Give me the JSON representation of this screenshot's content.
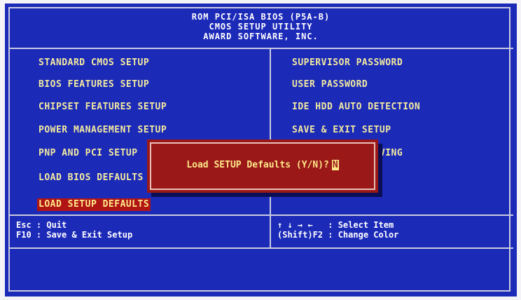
{
  "header": {
    "line1": "ROM PCI/ISA BIOS (P5A-B)",
    "line2": "CMOS SETUP UTILITY",
    "line3": "AWARD SOFTWARE, INC."
  },
  "menu_left": [
    {
      "label": "STANDARD CMOS SETUP"
    },
    {
      "label": "BIOS FEATURES SETUP"
    },
    {
      "label": "CHIPSET FEATURES SETUP"
    },
    {
      "label": "POWER MANAGEMENT SETUP"
    },
    {
      "label": "PNP AND PCI SETUP"
    },
    {
      "label": "LOAD BIOS DEFAULTS"
    },
    {
      "label": "LOAD SETUP DEFAULTS"
    }
  ],
  "menu_right": [
    {
      "label": "SUPERVISOR PASSWORD"
    },
    {
      "label": "USER PASSWORD"
    },
    {
      "label": "IDE HDD AUTO DETECTION"
    },
    {
      "label": "SAVE & EXIT SETUP"
    },
    {
      "label": "EXIT WITHOUT SAVING"
    }
  ],
  "selected_item": "LOAD SETUP DEFAULTS",
  "help": {
    "left1": "Esc : Quit",
    "left2": "F10 : Save & Exit Setup",
    "right1": "↑ ↓ → ←   : Select Item",
    "right2": "(Shift)F2 : Change Color"
  },
  "dialog": {
    "prompt": "Load SETUP Defaults (Y/N)?",
    "input_value": "N"
  },
  "colors": {
    "screen_bg": "#1c2ab8",
    "menu_text": "#f2eaa0",
    "highlight_bg": "#b01414",
    "dialog_bg": "#9a1818"
  }
}
